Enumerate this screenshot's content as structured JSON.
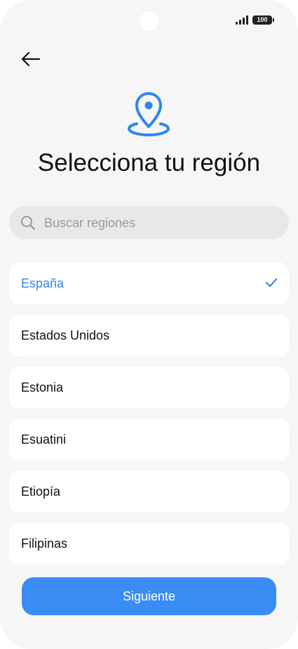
{
  "status_bar": {
    "battery_level": "100",
    "signal_icon": "signal-icon"
  },
  "header": {
    "back_icon": "arrow-left-icon",
    "region_icon": "location-pin-icon",
    "title": "Selecciona tu región"
  },
  "search": {
    "placeholder": "Buscar regiones",
    "value": "",
    "icon": "search-icon"
  },
  "regions": {
    "selected_index": 0,
    "items": [
      {
        "label": "España"
      },
      {
        "label": "Estados Unidos"
      },
      {
        "label": "Estonia"
      },
      {
        "label": "Esuatini"
      },
      {
        "label": "Etiopía"
      },
      {
        "label": "Filipinas"
      }
    ]
  },
  "footer": {
    "next_label": "Siguiente"
  },
  "colors": {
    "accent": "#3a8cf5",
    "selected_text": "#3a87e6",
    "background": "#f6f6f6"
  }
}
